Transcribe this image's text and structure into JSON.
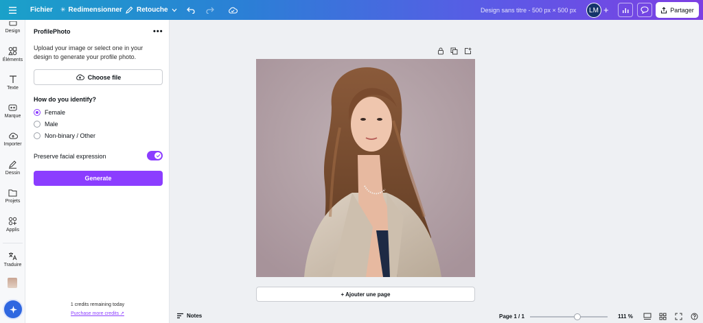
{
  "topbar": {
    "menu_icon": "hamburger-icon",
    "file_label": "Fichier",
    "resize_label": "Redimensionner",
    "retouch_label": "Retouche",
    "doc_title": "Design sans titre - 500 px × 500 px",
    "avatar_initials": "LM",
    "share_label": "Partager"
  },
  "rail": {
    "items": [
      {
        "label": "Design",
        "icon": "design-icon"
      },
      {
        "label": "Éléments",
        "icon": "elements-icon"
      },
      {
        "label": "Texte",
        "icon": "text-icon"
      },
      {
        "label": "Marque",
        "icon": "brand-icon"
      },
      {
        "label": "Importer",
        "icon": "upload-cloud-icon"
      },
      {
        "label": "Dessin",
        "icon": "draw-icon"
      },
      {
        "label": "Projets",
        "icon": "folder-icon"
      },
      {
        "label": "Applis",
        "icon": "apps-icon"
      },
      {
        "label": "Traduire",
        "icon": "translate-icon"
      }
    ]
  },
  "panel": {
    "title": "ProfilePhoto",
    "more": "•••",
    "description": "Upload your image or select one in your design to generate your profile photo.",
    "choose_file": "Choose file",
    "identify_heading": "How do you identify?",
    "options": [
      "Female",
      "Male",
      "Non-binary / Other"
    ],
    "selected_option": "Female",
    "preserve_label": "Preserve facial expression",
    "preserve_enabled": true,
    "generate_label": "Generate",
    "credits_text": "1 credits remaining today",
    "purchase_link": "Purchase more credits"
  },
  "canvas": {
    "add_page_label": "+ Ajouter une page"
  },
  "bottombar": {
    "notes_label": "Notes",
    "page_indicator": "Page 1 / 1",
    "zoom_label": "111 %"
  },
  "colors": {
    "accent": "#8b3dff",
    "topbar_start": "#1aa1c9",
    "topbar_end": "#7d3fe3"
  }
}
